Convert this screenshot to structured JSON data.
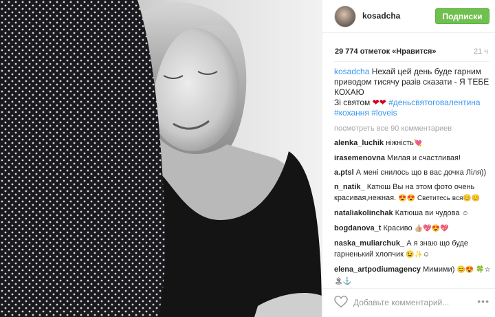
{
  "photo": {
    "alt": ""
  },
  "header": {
    "username": "kosadcha",
    "follow_label": "Подписки"
  },
  "meta": {
    "likes": "29 774 отметок «Нравится»",
    "time": "21 ч"
  },
  "caption": {
    "user": "kosadcha",
    "text": "Нехай цей день буде гарним приводом тисячу разів сказати - Я ТЕБЕ КОХАЮ",
    "line2": "Зі святом",
    "hearts": "❤❤",
    "tag1": "#деньсвятоговалентина",
    "tag2": "#кохання",
    "tag3": "#loveis"
  },
  "view_all": "посмотреть все 90 комментариев",
  "comments": [
    {
      "user": "alenka_luchik",
      "text": "ніжність",
      "emoji": "💘"
    },
    {
      "user": "irasemenovna",
      "text": "Милая и счастливая!",
      "emoji": ""
    },
    {
      "user": "a.ptsl",
      "text": "А мені снилось що в вас дочка Ліля))",
      "emoji": ""
    },
    {
      "user": "n_natik_",
      "text": "Катюш Вы на этом фото очень красивая,нежная.",
      "emoji": "😍😍 Светитесь вся😊😊"
    },
    {
      "user": "nataliakolinchak",
      "text": "Катюша ви чудова",
      "emoji": "☺"
    },
    {
      "user": "bogdanova_t",
      "text": "Красиво",
      "emoji": "👍🏼💖😍💖"
    },
    {
      "user": "naska_muliarchuk_",
      "text": "А я знаю що буде гарненький хлопчик",
      "emoji": "😉✨☺"
    },
    {
      "user": "elena_artpodiumagency",
      "text": "Мимими)",
      "emoji": "😊😍 🍀☆🏝⚓"
    }
  ],
  "add_comment": {
    "placeholder": "Добавьте комментарий...",
    "more": "•••"
  }
}
